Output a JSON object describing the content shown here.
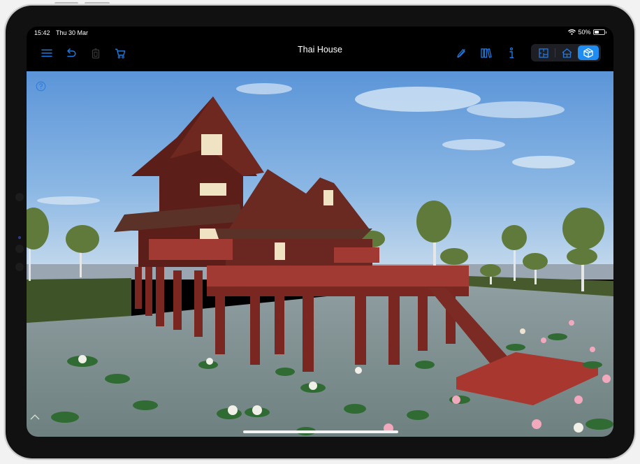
{
  "status_bar": {
    "time": "15:42",
    "date": "Thu 30 Mar",
    "battery_text": "50%",
    "battery_level": 0.5,
    "wifi_icon": "wifi-icon"
  },
  "toolbar": {
    "title": "Thai House",
    "left_icons": [
      "menu-icon",
      "undo-icon",
      "trash-icon",
      "cart-icon"
    ],
    "right_icons": [
      "pencil-slash-icon",
      "library-icon",
      "info-icon"
    ],
    "view_modes": [
      {
        "name": "2d-plan",
        "icon": "floorplan-icon",
        "active": false
      },
      {
        "name": "elevation",
        "icon": "house-elevation-icon",
        "active": false
      },
      {
        "name": "3d",
        "icon": "3d-box-icon",
        "active": true
      }
    ],
    "accent_color": "#1f8cf2"
  },
  "viewport": {
    "scene_description": "3D render of a red wooden Thai stilt house over a lily pond",
    "help_icon": "question-circle-icon",
    "expand_icon": "chevron-up-icon"
  }
}
